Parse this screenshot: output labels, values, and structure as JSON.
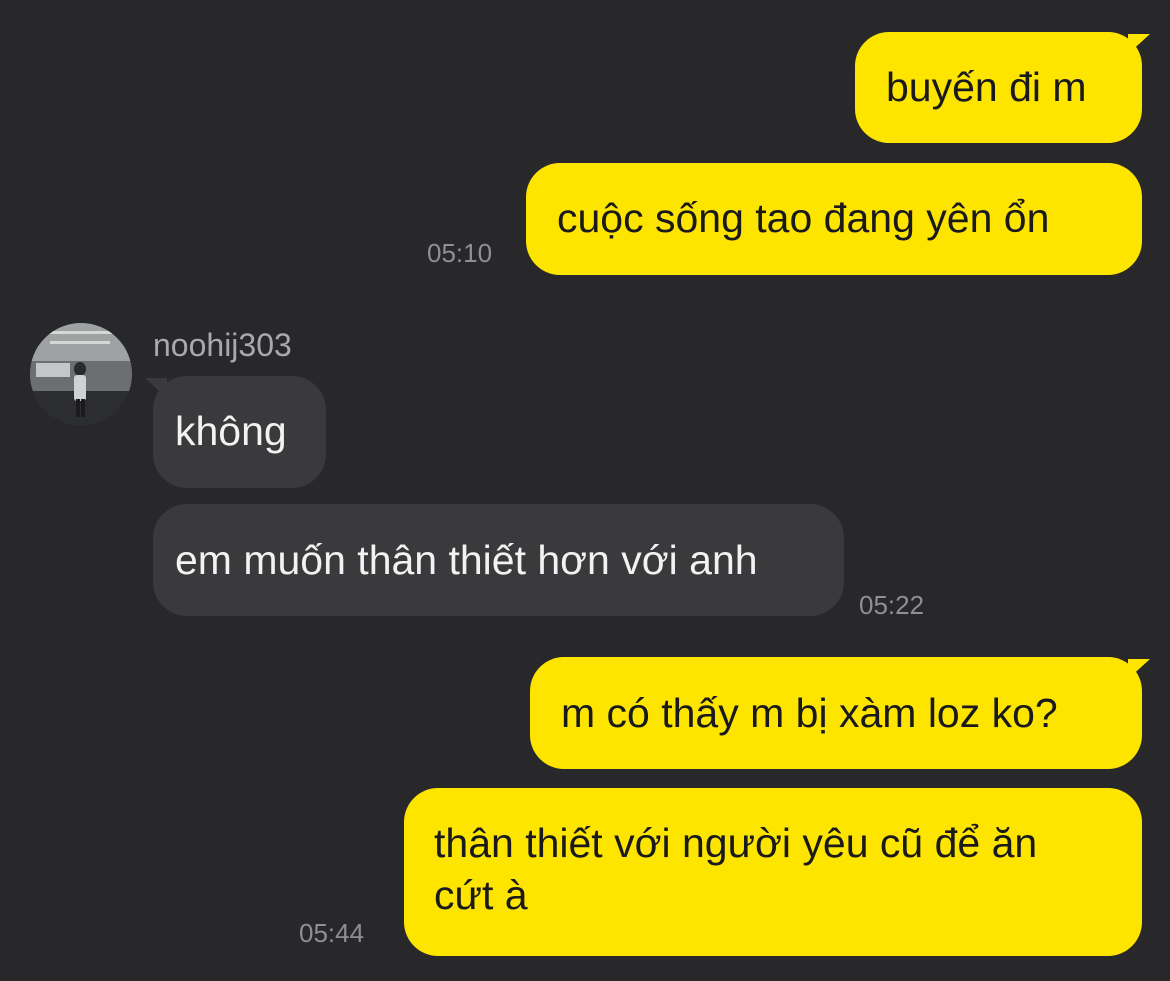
{
  "conversation": {
    "messages": [
      {
        "from": "me",
        "text": "buyến đi m"
      },
      {
        "from": "me",
        "text": "cuộc sống tao đang yên ổn",
        "time": "05:10"
      },
      {
        "from": "other",
        "text": "không"
      },
      {
        "from": "other",
        "text": "em muốn thân thiết hơn với anh",
        "time": "05:22"
      },
      {
        "from": "me",
        "text": "m có thấy m bị xàm loz ko?"
      },
      {
        "from": "me",
        "text_lines": [
          "thân thiết với người yêu cũ để ăn",
          "cứt à"
        ],
        "time": "05:44"
      }
    ],
    "other_sender": {
      "name": "noohij303",
      "avatar_icon": "profile-photo-avatar"
    }
  },
  "colors": {
    "background": "#28282a",
    "outgoing_bubble": "#fee500",
    "incoming_bubble": "#3a3a3c",
    "timestamp": "#8e8e93"
  }
}
